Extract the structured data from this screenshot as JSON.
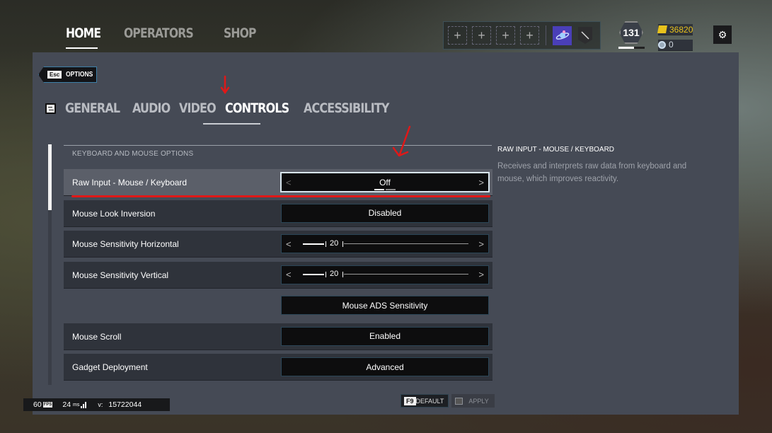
{
  "topnav": {
    "items": [
      {
        "label": "HOME",
        "active": true
      },
      {
        "label": "OPERATORS",
        "active": false
      },
      {
        "label": "SHOP",
        "active": false
      }
    ]
  },
  "loadout": {
    "slots": [
      "+",
      "+",
      "+",
      "+"
    ],
    "charm_icon": "planet-charm-icon",
    "badge_icon": "slash-badge-icon"
  },
  "player": {
    "level": "131",
    "level_progress": 0.6
  },
  "currency": {
    "renown": "36820",
    "credits": "0"
  },
  "options": {
    "back_key": "Esc",
    "back_label": "OPTIONS",
    "tabs": [
      {
        "label": "GENERAL",
        "active": false
      },
      {
        "label": "AUDIO",
        "active": false
      },
      {
        "label": "VIDEO",
        "active": false
      },
      {
        "label": "CONTROLS",
        "active": true
      },
      {
        "label": "ACCESSIBILITY",
        "active": false
      }
    ],
    "section_title": "KEYBOARD AND MOUSE OPTIONS",
    "rows": [
      {
        "label": "Raw Input - Mouse / Keyboard",
        "type": "selector",
        "value": "Off",
        "selected": true
      },
      {
        "label": "Mouse Look Inversion",
        "type": "button",
        "value": "Disabled"
      },
      {
        "label": "Mouse Sensitivity Horizontal",
        "type": "slider",
        "value": "20"
      },
      {
        "label": "Mouse Sensitivity Vertical",
        "type": "slider",
        "value": "20"
      },
      {
        "label": "",
        "type": "button",
        "value": "Mouse ADS Sensitivity"
      },
      {
        "label": "Mouse Scroll",
        "type": "button",
        "value": "Enabled"
      },
      {
        "label": "Gadget Deployment",
        "type": "button",
        "value": "Advanced"
      }
    ],
    "description": {
      "title": "RAW INPUT - MOUSE / KEYBOARD",
      "body": "Receives and interprets raw data from keyboard and mouse, which improves reactivity."
    },
    "footer": {
      "default_key": "F9",
      "default_label": "DEFAULT",
      "apply_label": "APPLY"
    }
  },
  "status": {
    "fps": "60",
    "fps_label": "FPS",
    "ping": "24",
    "ping_unit": "ms",
    "version_label": "v:",
    "version": "15722044"
  },
  "colors": {
    "panel": "#454a55",
    "annotation_red": "#e01818",
    "renown_gold": "#e8c21c"
  }
}
